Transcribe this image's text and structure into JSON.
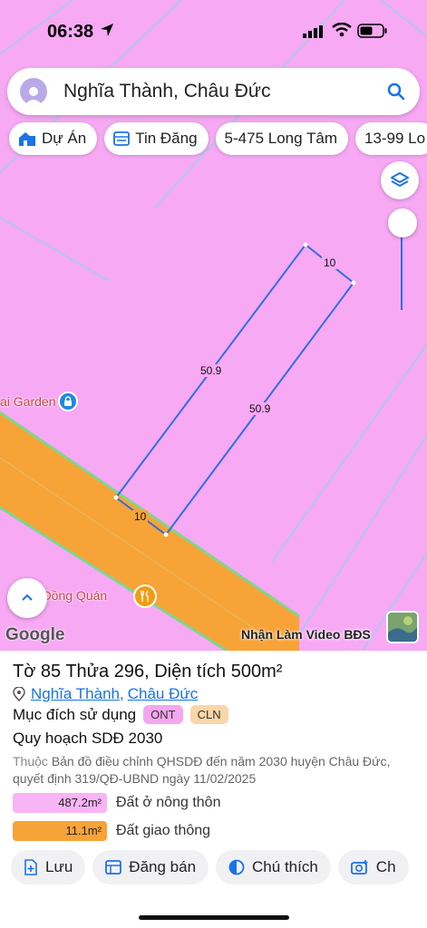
{
  "status_bar": {
    "time": "06:38"
  },
  "search": {
    "query": "Nghĩa Thành, Châu Đức"
  },
  "chips": [
    {
      "label": "Dự Án",
      "icon": "building-icon"
    },
    {
      "label": "Tin Đăng",
      "icon": "list-icon"
    },
    {
      "label": "5-475 Long Tâm",
      "icon": ""
    },
    {
      "label": "13-99 Lo",
      "icon": ""
    }
  ],
  "map": {
    "land_color": "#f7a9f4",
    "road_color": "#f7a338",
    "parcel_line_color": "#2f6fe0",
    "edge_labels": [
      "10",
      "50.9",
      "50.9",
      "10"
    ],
    "pois": {
      "garden": "ai Garden",
      "restaurant": "Gà Đồng Quán"
    },
    "google_logo": "Google",
    "watermark": "Nhận Làm Video BĐS"
  },
  "panel": {
    "title": "Tờ 85 Thửa 296, Diện tích 500m²",
    "location": {
      "commune": "Nghĩa Thành",
      "district": "Châu Đức"
    },
    "purpose_label": "Mục đích sử dụng",
    "purpose_badges": [
      "ONT",
      "CLN"
    ],
    "plan_title": "Quy hoạch SDĐ 2030",
    "plan_prefix": "Thuộc",
    "plan_desc": "Bản đồ điều chỉnh QHSDĐ đến năm 2030 huyện Châu Đức, quyết định 319/QĐ-UBND ngày 11/02/2025",
    "legend": [
      {
        "value": "487.2m²",
        "label": "Đất ở nông thôn",
        "color": "#f8b4f5"
      },
      {
        "value": "11.1m²",
        "label": "Đất giao thông",
        "color": "#f7a338"
      }
    ],
    "actions": [
      {
        "label": "Lưu",
        "icon": "save-icon"
      },
      {
        "label": "Đăng bán",
        "icon": "sell-icon"
      },
      {
        "label": "Chú thích",
        "icon": "legend-icon"
      },
      {
        "label": "Ch",
        "icon": "camera-icon"
      }
    ]
  }
}
